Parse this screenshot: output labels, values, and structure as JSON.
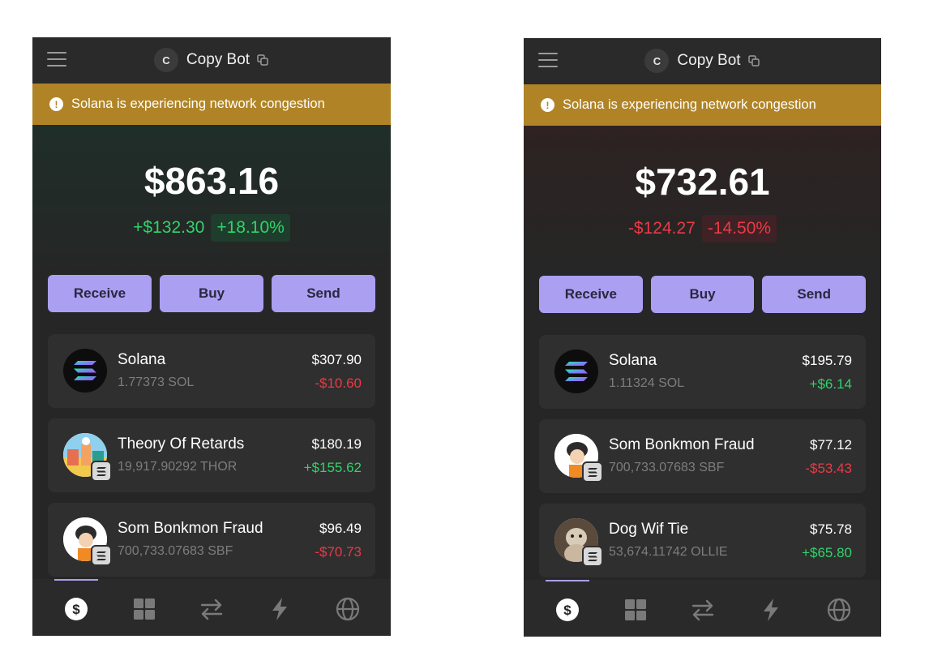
{
  "screens": [
    {
      "wallet_name": "Copy Bot",
      "wallet_avatar": "C",
      "banner_text": "Solana is experiencing network congestion",
      "balance": "$863.16",
      "change_abs": "+$132.30",
      "change_pct": "+18.10%",
      "trend": "positive",
      "actions": [
        "Receive",
        "Buy",
        "Send"
      ],
      "tokens": [
        {
          "name": "Solana",
          "amount": "1.77373 SOL",
          "value": "$307.90",
          "change": "-$10.60",
          "trend": "negative",
          "icon": "solana-logo-icon"
        },
        {
          "name": "Theory Of Retards",
          "amount": "19,917.90292 THOR",
          "value": "$180.19",
          "change": "+$155.62",
          "trend": "positive",
          "icon": "thor-token-icon"
        },
        {
          "name": "Som Bonkmon Fraud",
          "amount": "700,733.07683 SBF",
          "value": "$96.49",
          "change": "-$70.73",
          "trend": "negative",
          "icon": "sbf-token-icon"
        }
      ],
      "nav": [
        "dollar-icon",
        "grid-icon",
        "swap-icon",
        "lightning-icon",
        "globe-icon"
      ]
    },
    {
      "wallet_name": "Copy Bot",
      "wallet_avatar": "C",
      "banner_text": "Solana is experiencing network congestion",
      "balance": "$732.61",
      "change_abs": "-$124.27",
      "change_pct": "-14.50%",
      "trend": "negative",
      "actions": [
        "Receive",
        "Buy",
        "Send"
      ],
      "tokens": [
        {
          "name": "Solana",
          "amount": "1.11324 SOL",
          "value": "$195.79",
          "change": "+$6.14",
          "trend": "positive",
          "icon": "solana-logo-icon"
        },
        {
          "name": "Som Bonkmon Fraud",
          "amount": "700,733.07683 SBF",
          "value": "$77.12",
          "change": "-$53.43",
          "trend": "negative",
          "icon": "sbf-token-icon"
        },
        {
          "name": "Dog Wif Tie",
          "amount": "53,674.11742 OLLIE",
          "value": "$75.78",
          "change": "+$65.80",
          "trend": "positive",
          "icon": "dog-token-icon"
        }
      ],
      "nav": [
        "dollar-icon",
        "grid-icon",
        "swap-icon",
        "lightning-icon",
        "globe-icon"
      ]
    }
  ],
  "colors": {
    "accent": "#ab9ff2",
    "banner": "#b08426",
    "positive": "#2fd46a",
    "negative": "#eb3a45",
    "background": "#262626"
  }
}
